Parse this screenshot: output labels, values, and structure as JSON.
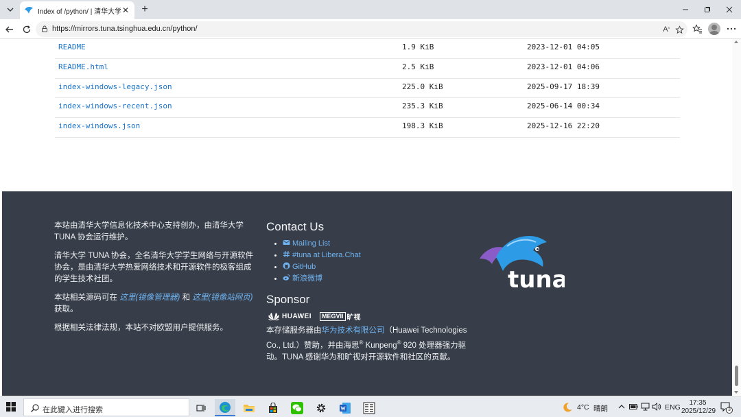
{
  "browser": {
    "tab_title": "Index of /python/ | 清华大学开源软件镜像站",
    "url": "https://mirrors.tuna.tsinghua.edu.cn/python/"
  },
  "files": [
    {
      "name": "README",
      "size": "1.9 KiB",
      "date": "2023-12-01 04:05"
    },
    {
      "name": "README.html",
      "size": "2.5 KiB",
      "date": "2023-12-01 04:06"
    },
    {
      "name": "index-windows-legacy.json",
      "size": "225.0 KiB",
      "date": "2025-09-17 18:39"
    },
    {
      "name": "index-windows-recent.json",
      "size": "235.3 KiB",
      "date": "2025-06-14 00:34"
    },
    {
      "name": "index-windows.json",
      "size": "198.3 KiB",
      "date": "2025-12-16 22:20"
    }
  ],
  "footer": {
    "about": {
      "p1": "本站由清华大学信息化技术中心支持创办，由清华大学 TUNA 协会运行维护。",
      "p2": "清华大学 TUNA 协会，全名清华大学学生网络与开源软件协会，是由清华大学热爱网络技术和开源软件的极客组成的学生技术社团。",
      "p3_before": "本站相关源码可在 ",
      "p3_link1": "这里(镜像管理器)",
      "p3_mid": " 和 ",
      "p3_link2": "这里(镜像站网页)",
      "p3_after": " 获取。",
      "p4": "根据相关法律法规，本站不对欧盟用户提供服务。"
    },
    "contact_title": "Contact Us",
    "contacts": [
      {
        "label": "Mailing List",
        "icon": "envelope-icon"
      },
      {
        "label": "#tuna at Libera.Chat",
        "icon": "hashtag-icon"
      },
      {
        "label": "GitHub",
        "icon": "github-icon"
      },
      {
        "label": "新浪微博",
        "icon": "weibo-icon"
      }
    ],
    "sponsor_title": "Sponsor",
    "sponsor_logos": {
      "huawei": "HUAWEI",
      "megvii_box": "MEGVII",
      "megvii_cn": "旷视"
    },
    "sponsor": {
      "before": "本存储服务器由",
      "link": "华为技术有限公司",
      "after_link": "（Huawei Technologies Co., Ltd.）赞助，并由海思",
      "sup1": "®",
      "mid": " Kunpeng",
      "sup2": "®",
      "after": " 920 处理器强力驱动。TUNA 感谢华为和旷视对开源软件和社区的贡献。"
    },
    "logo_text": "tuna"
  },
  "taskbar": {
    "search_placeholder": "在此键入进行搜索",
    "weather_temp": "4°C",
    "weather_desc": "晴朗",
    "ime": "ENG",
    "time": "17:35",
    "date": "2025/12/29",
    "notification_count": "3"
  },
  "colors": {
    "link": "#1a73c8",
    "footer_bg": "#373e49",
    "footer_link": "#6fb3f2"
  }
}
